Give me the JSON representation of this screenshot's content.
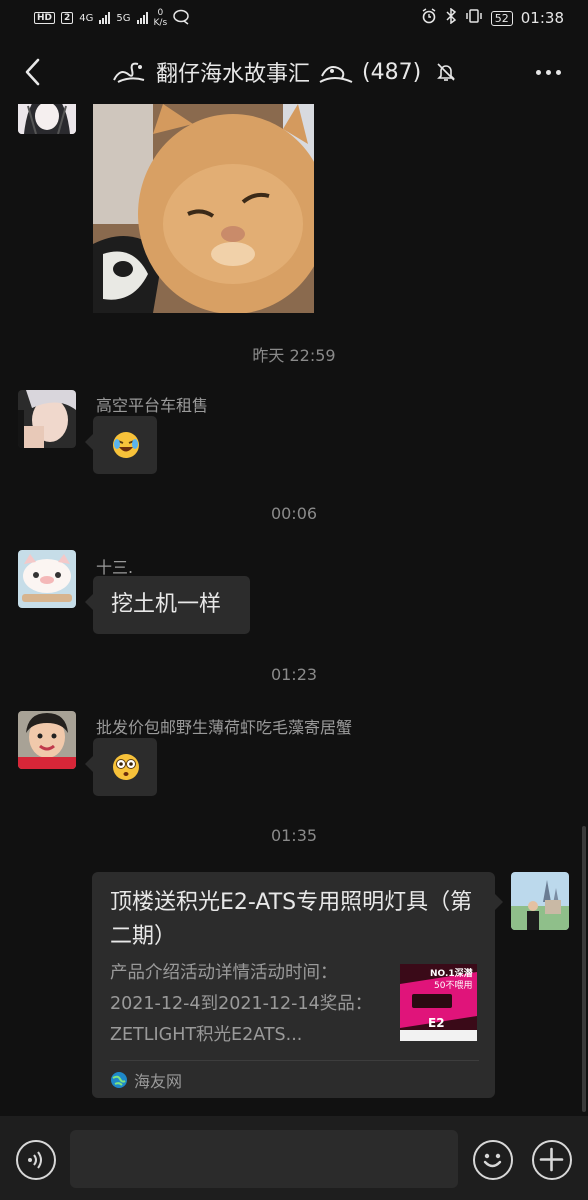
{
  "status_bar": {
    "hd_tag": "HD",
    "sim1_tag": "2",
    "net1": "4G",
    "net2": "5G",
    "speed_value": "0",
    "speed_unit": "K/s",
    "battery": "52",
    "clock": "01:38"
  },
  "header": {
    "title": "翻仔海水故事汇",
    "member_count": "(487)"
  },
  "messages": [
    {
      "type": "image",
      "description": "cat photo"
    },
    {
      "type": "time",
      "text": "昨天 22:59"
    },
    {
      "type": "text",
      "sender": "高空平台车租售",
      "emoji": "laughing-crying-emoji"
    },
    {
      "type": "time",
      "text": "00:06"
    },
    {
      "type": "text",
      "sender": "十三.",
      "text": "挖土机一样"
    },
    {
      "type": "time",
      "text": "01:23"
    },
    {
      "type": "text",
      "sender": "批发价包邮野生薄荷虾吃毛藻寄居蟹",
      "emoji": "flushed-emoji"
    },
    {
      "type": "time",
      "text": "01:35"
    }
  ],
  "link_card": {
    "title": "顶楼送积光E2-ATS专用照明灯具（第二期）",
    "description": "产品介绍活动详情活动时间：2021-12-4到2021-12-14奖品：ZETLIGHT积光E2ATS...",
    "thumb_line1": "NO.1深潜",
    "thumb_line2": "50不喂用",
    "thumb_label": "E2",
    "source": "海友网"
  },
  "colors": {
    "background": "#111111",
    "bubble": "#2c2c2c",
    "bar": "#1e1e1e",
    "thumb": "#e0147a"
  }
}
